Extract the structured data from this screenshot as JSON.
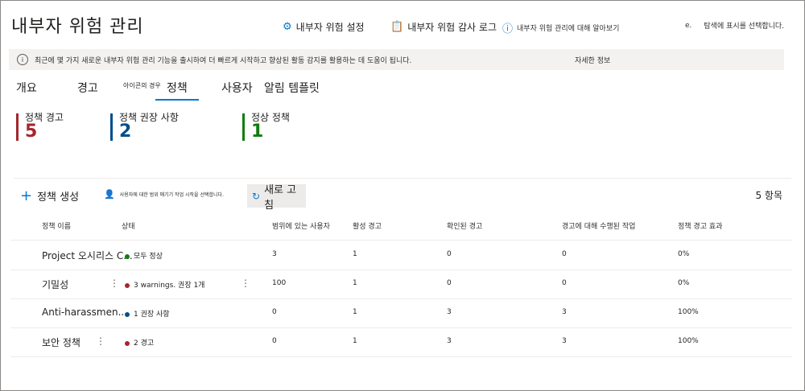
{
  "header": {
    "title": "내부자 위험 관리",
    "settings_label": "내부자 위험 설정",
    "audit_label": "내부자 위험 감사 로그",
    "learn_label": "내부자 위험 관리에 대해 알아보기",
    "nav_prefix": "e.",
    "nav_text": "탐색에 표시를 선택합니다."
  },
  "banner": {
    "text": "최근에 몇 가지 새로운 내부자 위험 관리 기능을 출시하여 더 빠르게 시작하고 향상된 활동 감지를 활용하는 데 도움이 됩니다.",
    "more": "자세한 정보"
  },
  "tabs": [
    "개요",
    "경고",
    "아이콘의 경우",
    "정책",
    "사용자",
    "알림 템플릿"
  ],
  "cards": [
    {
      "label": "정책 경고",
      "value": "5",
      "color": "#a4262c"
    },
    {
      "label": "정책 권장 사항",
      "value": "2",
      "color": "#004e8c"
    },
    {
      "label": "정상 정책",
      "value": "1",
      "color": "#107c10"
    }
  ],
  "commands": {
    "create": "정책 생성",
    "start_scope": "사용자에 대한 범위 매기기 작업 시작을 선택합니다.",
    "refresh": "새로 고침",
    "count": "5 항목"
  },
  "columns": [
    "정책 이름",
    "상태",
    "범위에 있는 사용자",
    "활성 경고",
    "확인된 경고",
    "경고에 대해 수행된 작업",
    "정책 경고 효과"
  ],
  "rows": [
    {
      "name": "Project 오시리스 C...",
      "status": "모두 정상",
      "status_color": "#107c10",
      "users": "3",
      "active": "1",
      "confirmed": "0",
      "actions": "0",
      "effect": "0%"
    },
    {
      "name": "기밀성",
      "status": "3 warnings. 권장 1개",
      "status_color": "#a4262c",
      "users": "100",
      "active": "1",
      "confirmed": "0",
      "actions": "0",
      "effect": "0%"
    },
    {
      "name": "Anti-harassmen...",
      "status": "1 권장 사항",
      "status_color": "#004e8c",
      "users": "0",
      "active": "1",
      "confirmed": "3",
      "actions": "3",
      "effect": "100%"
    },
    {
      "name": "보안 정책",
      "status": "2 경고",
      "status_color": "#a4262c",
      "users": "0",
      "active": "1",
      "confirmed": "3",
      "actions": "3",
      "effect": "100%"
    }
  ]
}
